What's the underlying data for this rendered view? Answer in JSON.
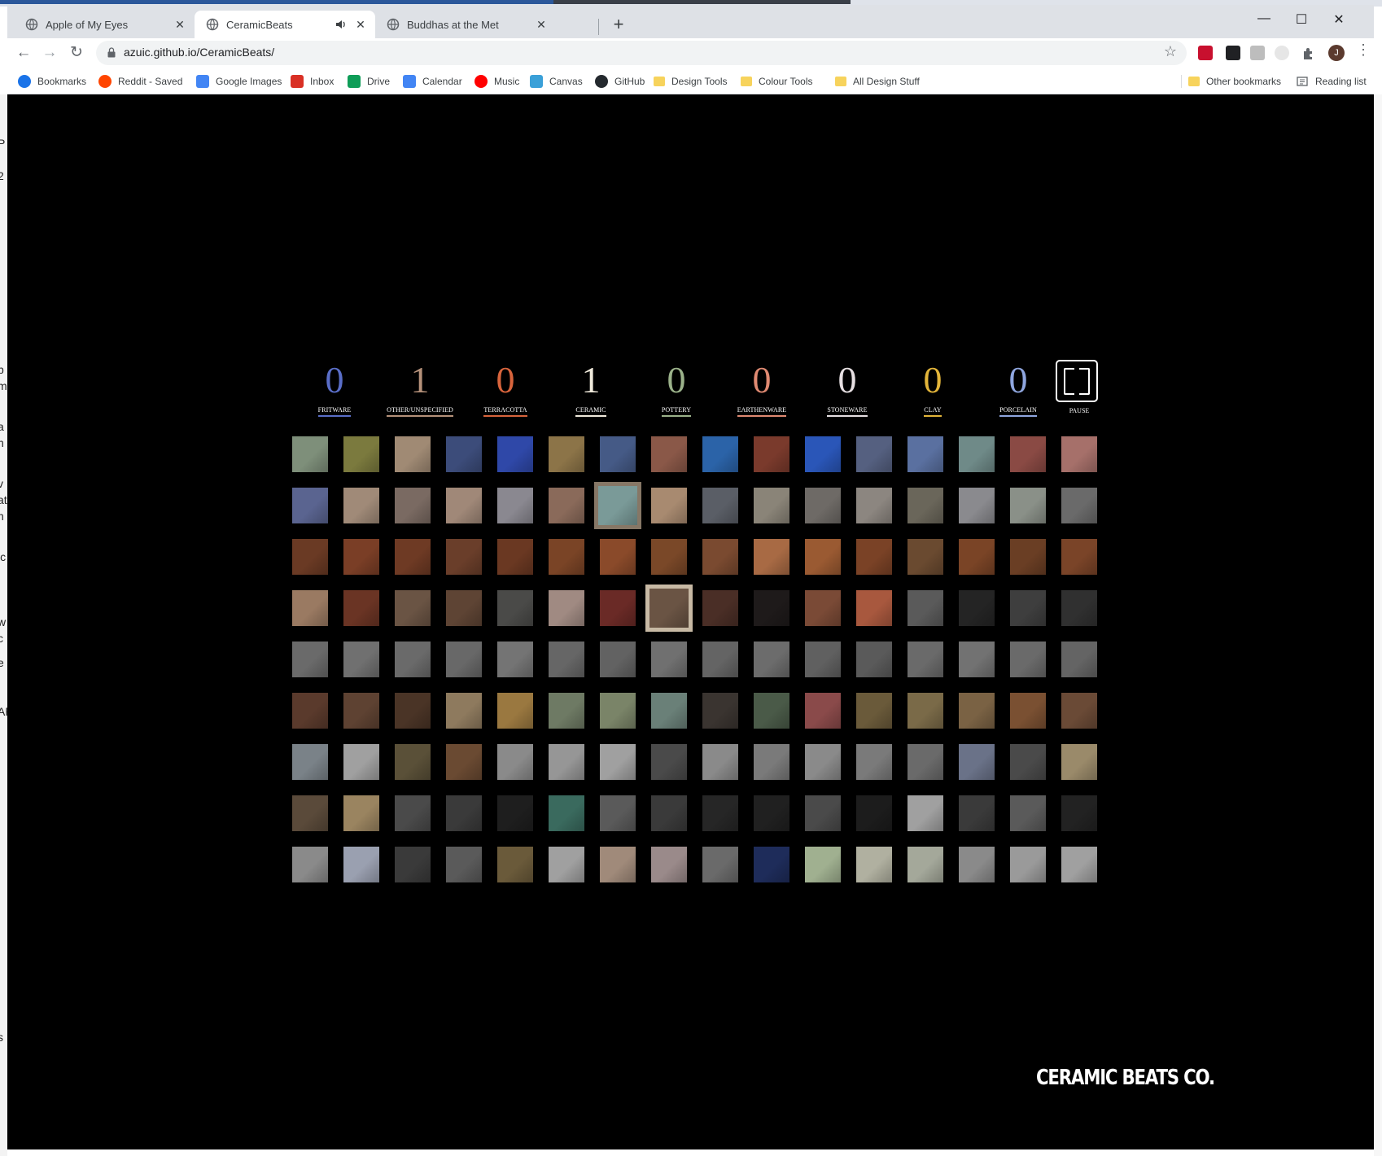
{
  "browser": {
    "tabs": [
      {
        "title": "Apple of My Eyes",
        "active": false
      },
      {
        "title": "CeramicBeats",
        "active": true,
        "playing_audio": true
      },
      {
        "title": "Buddhas at the Met",
        "active": false
      }
    ],
    "new_tab_label": "+",
    "window_controls": {
      "minimize": "—",
      "maximize": "☐",
      "close": "✕"
    },
    "nav": {
      "back": "←",
      "forward": "→",
      "reload": "↻"
    },
    "url": "azuic.github.io/CeramicBeats/",
    "star": "☆",
    "avatar_initial": "J",
    "menu": "⋮",
    "bookmarks": [
      {
        "label": "Bookmarks",
        "icon": "star-icon",
        "color": "#1a73e8"
      },
      {
        "label": "Reddit - Saved",
        "icon": "reddit-icon",
        "color": "#ff4500"
      },
      {
        "label": "Google Images",
        "icon": "google-icon",
        "color": "#4285f4"
      },
      {
        "label": "Inbox",
        "icon": "gmail-icon",
        "color": "#d93025"
      },
      {
        "label": "Drive",
        "icon": "drive-icon",
        "color": "#0f9d58"
      },
      {
        "label": "Calendar",
        "icon": "calendar-icon",
        "color": "#4285f4"
      },
      {
        "label": "Music",
        "icon": "music-icon",
        "color": "#ff0000"
      },
      {
        "label": "Canvas",
        "icon": "canvas-icon",
        "color": "#3aa0d8"
      },
      {
        "label": "GitHub",
        "icon": "github-icon",
        "color": "#24292e"
      },
      {
        "label": "Design Tools",
        "icon": "folder-icon",
        "color": "#f7d35c"
      },
      {
        "label": "Colour Tools",
        "icon": "folder-icon",
        "color": "#f7d35c"
      },
      {
        "label": "All Design Stuff",
        "icon": "folder-icon",
        "color": "#f7d35c"
      }
    ],
    "other_bookmarks": "Other bookmarks",
    "reading_list": "Reading list"
  },
  "app": {
    "counters": [
      {
        "value": "0",
        "label": "FRITWARE",
        "color": "#5a6ec8"
      },
      {
        "value": "1",
        "label": "OTHER/UNSPECIFIED",
        "color": "#b5917a"
      },
      {
        "value": "0",
        "label": "TERRACOTTA",
        "color": "#d8643c"
      },
      {
        "value": "1",
        "label": "CERAMIC",
        "color": "#f0eadc"
      },
      {
        "value": "0",
        "label": "POTTERY",
        "color": "#9bb28a"
      },
      {
        "value": "0",
        "label": "EARTHENWARE",
        "color": "#e08a72"
      },
      {
        "value": "0",
        "label": "STONEWARE",
        "color": "#e6dfe2"
      },
      {
        "value": "0",
        "label": "CLAY",
        "color": "#e3b53a"
      },
      {
        "value": "0",
        "label": "PORCELAIN",
        "color": "#8fa6df"
      }
    ],
    "pause_label": "PAUSE",
    "brand": "CERAMIC BEATS CO.",
    "tile_rows": [
      [
        "#7e8f7a",
        "#7b7a3e",
        "#a08a74",
        "#3c4c7a",
        "#2f48a8",
        "#8c7448",
        "#455a86",
        "#8a5848",
        "#2b63a8",
        "#7a3a2c",
        "#2a56b8",
        "#556080",
        "#5a70a0",
        "#6f8a88",
        "#8a4a44",
        "#a6706a"
      ],
      [
        "#5a6490",
        "#a08a78",
        "#7a6a62",
        "#a08878",
        "#8a8890",
        "#8a6a5a",
        "#7a9a98",
        "#a88a70",
        "#5a5e66",
        "#8a8478",
        "#6e6a66",
        "#8c8680",
        "#6a665a",
        "#8a8a8e",
        "#8a9088",
        "#6a6a6a"
      ],
      [
        "#6a3a24",
        "#7a3e26",
        "#6e3a24",
        "#6a3e2a",
        "#6a3822",
        "#7a4426",
        "#8a4a2a",
        "#7a4828",
        "#7a4a30",
        "#a86a44",
        "#9a5a32",
        "#7a4226",
        "#6a4a30",
        "#7a4426",
        "#6a3e24",
        "#7a4428"
      ],
      [
        "#9a7a62",
        "#6a3424",
        "#6a5444",
        "#5e4434",
        "#4a4a48",
        "#a08a82",
        "#6a2a26",
        "#6a5444",
        "#4a2e26",
        "#1e1a1a",
        "#7a4a36",
        "#a8583e",
        "#5a5a5a",
        "#242424",
        "#3e3e3e",
        "#303030"
      ],
      [
        "#6a6a6a",
        "#707070",
        "#6a6a6a",
        "#686868",
        "#747474",
        "#666666",
        "#626262",
        "#707070",
        "#646464",
        "#6c6c6c",
        "#606060",
        "#5a5a5a",
        "#6a6a6a",
        "#727272",
        "#6a6a6a",
        "#646464"
      ],
      [
        "#5a3a2c",
        "#5e4232",
        "#4a3426",
        "#8e7a5e",
        "#9a7840",
        "#6e7a64",
        "#7a8468",
        "#6a8078",
        "#3a3430",
        "#4a5a48",
        "#8a4a4a",
        "#6a5a3a",
        "#7a6a48",
        "#7a6244",
        "#7a5032",
        "#6a4a36"
      ],
      [
        "#7a8288",
        "#a0a0a0",
        "#5a5038",
        "#6a4a32",
        "#8a8a8a",
        "#969696",
        "#a0a0a0",
        "#4a4a4a",
        "#8a8a8a",
        "#7a7a7a",
        "#8a8a8a",
        "#7a7a7a",
        "#6a6a6a",
        "#6a7288",
        "#4a4a4a",
        "#9a8a6a"
      ],
      [
        "#5a4a3a",
        "#9a8460",
        "#4a4a4a",
        "#3a3a3a",
        "#1e1e1e",
        "#3a6a5e",
        "#5a5a5a",
        "#3a3a3a",
        "#262626",
        "#202020",
        "#4a4a4a",
        "#1c1c1c",
        "#a0a0a0",
        "#3a3a3a",
        "#5a5a5a",
        "#222222"
      ],
      [
        "#8a8a8a",
        "#9aa0b0",
        "#3a3a3a",
        "#5a5a5a",
        "#6a5a3a",
        "#a0a0a0",
        "#a08a7a",
        "#9a8a8a",
        "#6a6a6a",
        "#1e2c5a",
        "#a0b090",
        "#b0b0a0",
        "#a4a89a",
        "#8a8a8a",
        "#9a9a9a",
        "#a0a0a0"
      ]
    ],
    "selected_tiles": [
      [
        1,
        6
      ],
      [
        3,
        7
      ]
    ]
  },
  "background": {
    "left_fragments": [
      "P",
      "2",
      "p",
      "m",
      "a",
      "h",
      "v",
      "at",
      "h",
      "ic",
      "w",
      "c",
      "e",
      "AR",
      "s"
    ]
  }
}
